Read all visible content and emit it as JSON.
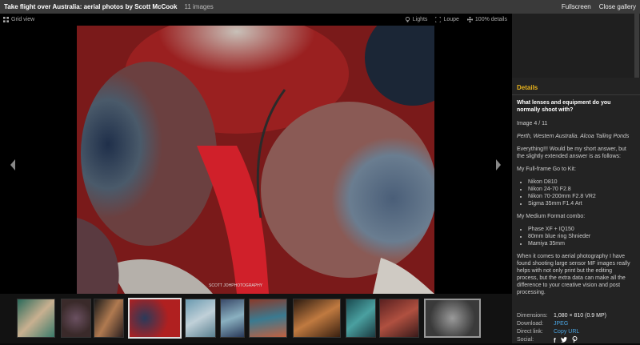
{
  "header": {
    "title": "Take flight over Australia: aerial photos by Scott McCook",
    "image_count": "11 images",
    "fullscreen": "Fullscreen",
    "close": "Close gallery"
  },
  "toolbar": {
    "grid_view": "Grid view",
    "lights": "Lights",
    "loupe": "Loupe",
    "zoom": "100% details"
  },
  "photo": {
    "watermark": "SCOTT  JOHPHOTOGRAPHY"
  },
  "details": {
    "heading": "Details",
    "question": "What lenses and equipment do you normally shoot with?",
    "image_index": "Image 4 / 11",
    "location": "Perth, Western Australia. Alcoa Tailing Ponds",
    "answer_intro": "Everything!!! Would be my short answer, but the slightly extended answer is as follows:",
    "full_frame_heading": "My Full-frame Go to Kit:",
    "full_frame_items": [
      "Nikon D810",
      "Nikon 24-70 F2.8",
      "Nikon 70-200mm F2.8 VR2",
      "Sigma 35mm F1.4 Art"
    ],
    "medium_heading": "My Medium Format combo:",
    "medium_items": [
      "Phase XF + IQ150",
      "80mm blue ring Shnieder",
      "Mamiya 35mm"
    ],
    "closing": "When it comes to aerial photography I have found shooting large sensor MF images really helps with not only print but the editing process, but the extra data can make all the difference to your creative vision and post processing."
  },
  "meta": {
    "dimensions_label": "Dimensions:",
    "dimensions_value": "1,080 × 810 (0.9 MP)",
    "download_label": "Download:",
    "download_value": "JPEG",
    "direct_label": "Direct link:",
    "direct_value": "Copy URL",
    "social_label": "Social:",
    "social_icons": [
      "facebook-icon",
      "twitter-icon",
      "pinterest-icon"
    ]
  },
  "colors": {
    "accent": "#e8b21c",
    "link": "#4aa3df"
  }
}
